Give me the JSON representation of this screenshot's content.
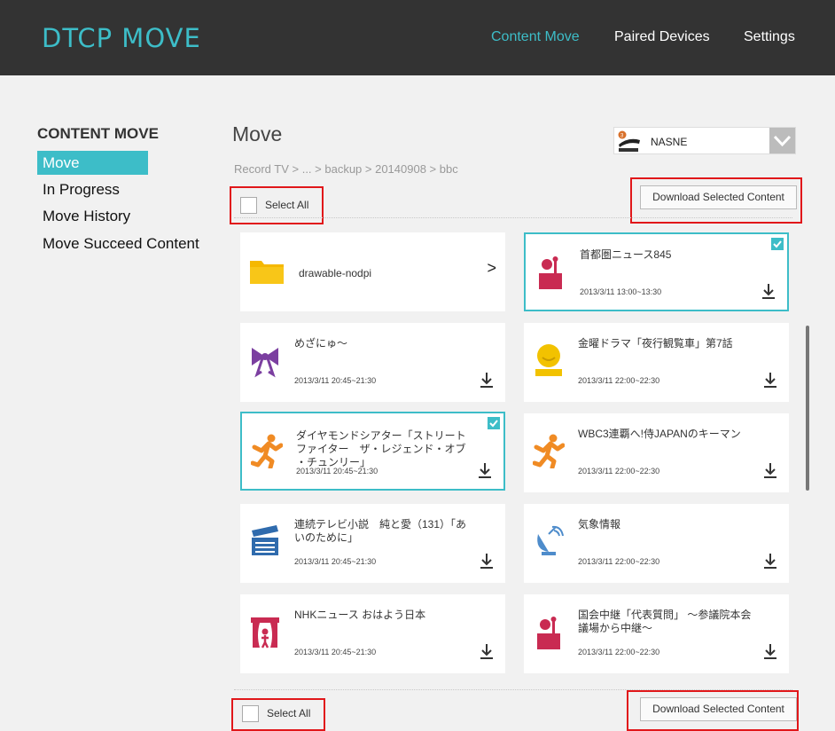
{
  "app": {
    "title": "DTCP MOVE",
    "colors": {
      "accent": "#3dbdc8",
      "header_bg": "#333333",
      "highlight": "#e1171a"
    }
  },
  "nav": {
    "items": [
      {
        "label": "Content Move",
        "active": true
      },
      {
        "label": "Paired Devices"
      },
      {
        "label": "Settings"
      }
    ]
  },
  "sidebar": {
    "title": "CONTENT MOVE",
    "items": [
      {
        "label": "Move",
        "active": true
      },
      {
        "label": "In Progress"
      },
      {
        "label": "Move History"
      },
      {
        "label": "Move Succeed Content"
      }
    ]
  },
  "main": {
    "title": "Move",
    "device": {
      "name": "NASNE",
      "icon": "nasne-logo-icon"
    },
    "breadcrumb": "Record TV > ... >  backup > 20140908 > bbc",
    "select_all_label": "Select All",
    "download_label": "Download Selected Content",
    "folder": {
      "name": "drawable-nodpi",
      "arrow": ">"
    },
    "items": [
      {
        "title": "首都圏ニュース845",
        "time": "2013/3/11 13:00~13:30",
        "icon": "news-anchor-icon",
        "selected": true
      },
      {
        "title": "めざにゅ〜",
        "time": "2013/3/11 20:45~21:30",
        "icon": "ribbon-icon",
        "selected": false
      },
      {
        "title": "金曜ドラマ「夜行観覧車」第7話",
        "time": "2013/3/11 22:00~22:30",
        "icon": "smiley-icon",
        "selected": false
      },
      {
        "title": "ダイヤモンドシアター「ストリート ファイター　ザ・レジェンド・オブ ・チュンリー」",
        "time": "2013/3/11 20:45~21:30",
        "icon": "runner-icon",
        "selected": true
      },
      {
        "title": "WBC3連覇へ!侍JAPANのキーマン",
        "time": "2013/3/11 22:00~22:30",
        "icon": "runner-icon",
        "selected": false
      },
      {
        "title": "連続テレビ小説　純と愛（131）「あいのために」",
        "time": "2013/3/11 20:45~21:30",
        "icon": "clapperboard-icon",
        "selected": false
      },
      {
        "title": "気象情報",
        "time": "2013/3/11 22:00~22:30",
        "icon": "satellite-dish-icon",
        "selected": false
      },
      {
        "title": "NHKニュース おはよう日本",
        "time": "2013/3/11 20:45~21:30",
        "icon": "theater-icon",
        "selected": false
      },
      {
        "title": "国会中継「代表質問」 〜参議院本会議場から中継〜",
        "time": "2013/3/11 22:00~22:30",
        "icon": "news-anchor-icon",
        "selected": false
      }
    ]
  }
}
